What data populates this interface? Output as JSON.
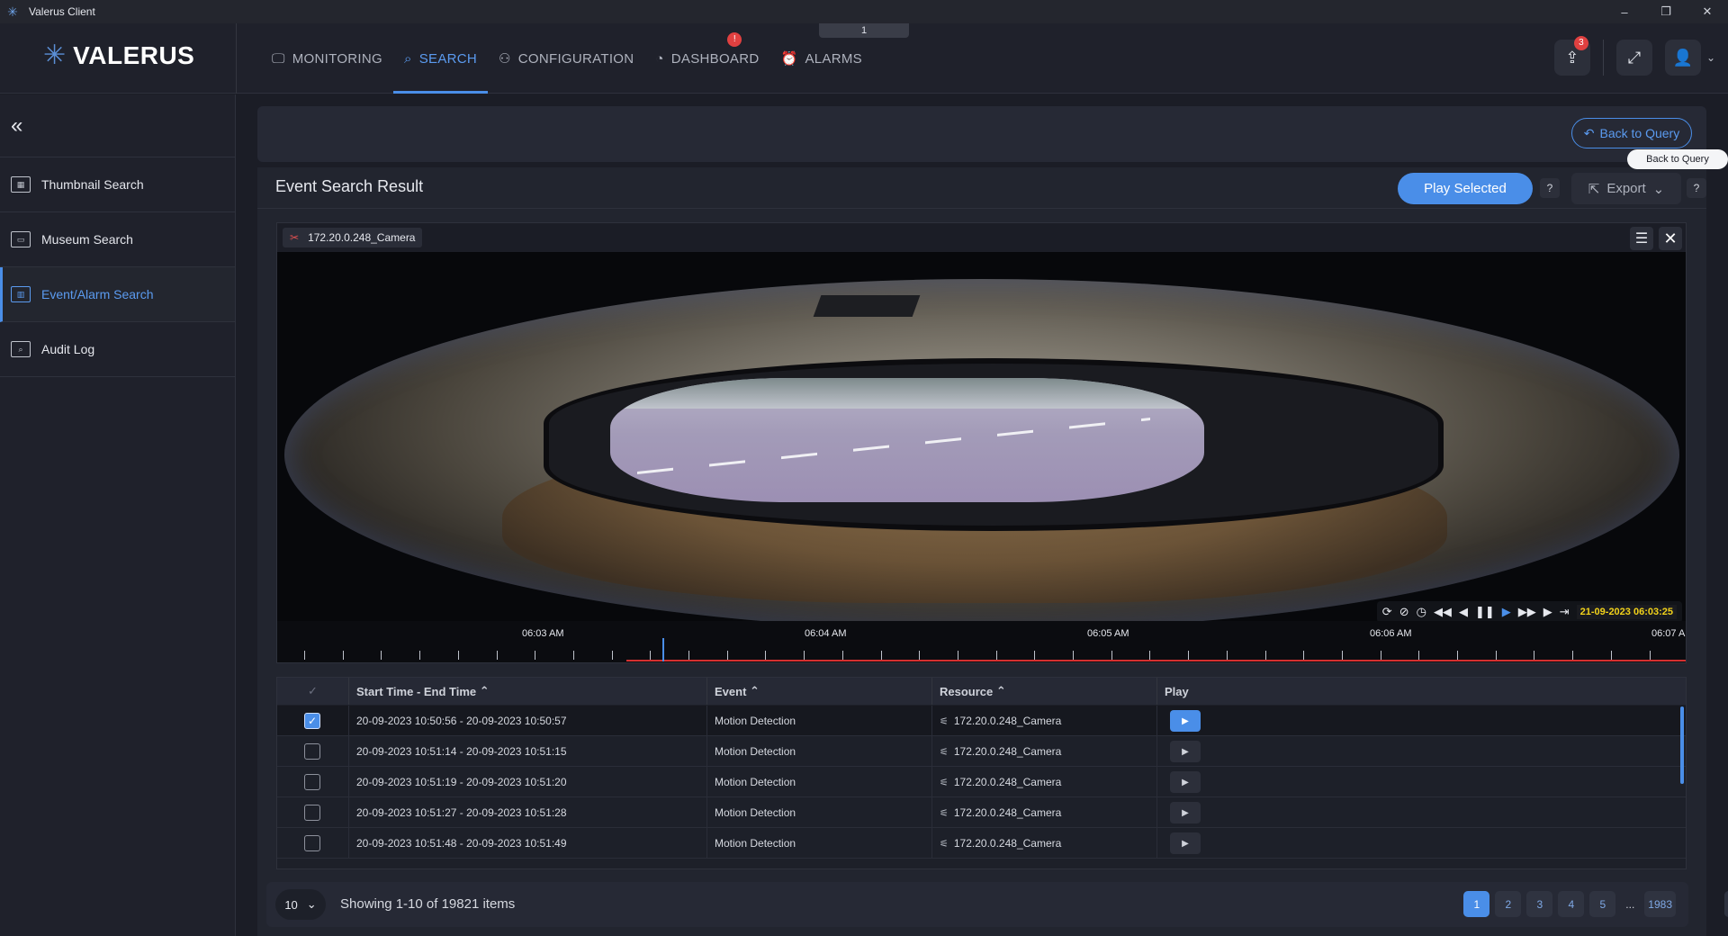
{
  "window": {
    "title": "Valerus Client",
    "controls": [
      "–",
      "❐",
      "✕"
    ]
  },
  "brand": {
    "name": "VALERUS"
  },
  "page_tab_number": "1",
  "nav": [
    {
      "label": "MONITORING",
      "icon": "monitor-icon",
      "glyph": "🖵"
    },
    {
      "label": "SEARCH",
      "icon": "search-icon",
      "glyph": "⌕"
    },
    {
      "label": "CONFIGURATION",
      "icon": "network-icon",
      "glyph": "⚇"
    },
    {
      "label": "DASHBOARD",
      "icon": "gauge-icon",
      "glyph": "◔"
    },
    {
      "label": "ALARMS",
      "icon": "alarm-icon",
      "glyph": "⏰"
    }
  ],
  "nav_active": "SEARCH",
  "dashboard_alert": "!",
  "top_right": {
    "share_badge": "3"
  },
  "sidebar": {
    "collapse_glyph": "«",
    "items": [
      {
        "label": "Thumbnail Search",
        "glyph": "▦"
      },
      {
        "label": "Museum Search",
        "glyph": "▭"
      },
      {
        "label": "Event/Alarm Search",
        "glyph": "▥"
      },
      {
        "label": "Audit Log",
        "glyph": "⌕"
      }
    ],
    "active": "Event/Alarm Search"
  },
  "query": {
    "back_label": "Back to Query",
    "tooltip": "Back to Query"
  },
  "results": {
    "title": "Event Search Result",
    "play_selected": "Play Selected",
    "help": "?",
    "export": "Export"
  },
  "video": {
    "camera": "172.20.0.248_Camera",
    "timestamp": "21-09-2023 06:03:25",
    "timeline_labels": [
      "06:03 AM",
      "06:04 AM",
      "06:05 AM",
      "06:06 AM",
      "06:07 A"
    ]
  },
  "table": {
    "columns": [
      "Start Time - End Time",
      "Event",
      "Resource",
      "Play"
    ],
    "rows": [
      {
        "time": "20-09-2023 10:50:56  - 20-09-2023 10:50:57",
        "event": "Motion Detection",
        "resource": "172.20.0.248_Camera",
        "checked": true
      },
      {
        "time": "20-09-2023 10:51:14  - 20-09-2023 10:51:15",
        "event": "Motion Detection",
        "resource": "172.20.0.248_Camera",
        "checked": false
      },
      {
        "time": "20-09-2023 10:51:19  - 20-09-2023 10:51:20",
        "event": "Motion Detection",
        "resource": "172.20.0.248_Camera",
        "checked": false
      },
      {
        "time": "20-09-2023 10:51:27  - 20-09-2023 10:51:28",
        "event": "Motion Detection",
        "resource": "172.20.0.248_Camera",
        "checked": false
      },
      {
        "time": "20-09-2023 10:51:48  - 20-09-2023 10:51:49",
        "event": "Motion Detection",
        "resource": "172.20.0.248_Camera",
        "checked": false
      }
    ]
  },
  "pagination": {
    "per_page": "10",
    "showing": "Showing 1-10 of 19821 items",
    "pages": [
      "1",
      "2",
      "3",
      "4",
      "5"
    ],
    "ellipsis": "...",
    "last_page": "1983",
    "current": "1"
  },
  "colors": {
    "accent": "#4a8ee8",
    "alert": "#e04040",
    "timestamp": "#f2d21a",
    "timeline_red": "#d53030"
  }
}
